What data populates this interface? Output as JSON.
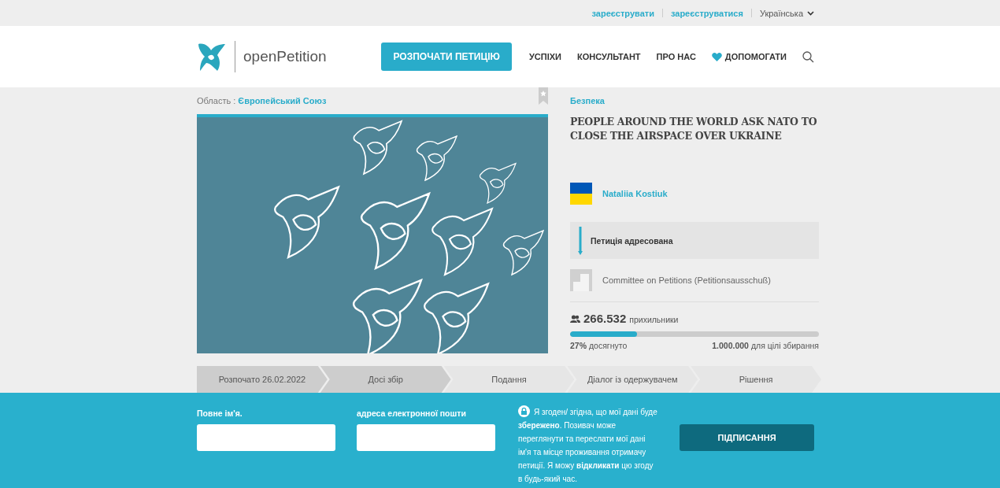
{
  "top_bar": {
    "links": [
      "зареєструвати",
      "зареєструватися"
    ],
    "language": "Українська"
  },
  "header": {
    "logo_text": "openPetition",
    "start_button": "РОЗПОЧАТИ ПЕТИЦІЮ",
    "nav": [
      {
        "label": "УСПІХИ",
        "kind": "plain"
      },
      {
        "label": "КОНСУЛЬТАНТ",
        "kind": "plain"
      },
      {
        "label": "ПРО НАС",
        "kind": "plain"
      },
      {
        "label": "ДОПОМОГАТИ",
        "kind": "heart"
      }
    ]
  },
  "region": {
    "label": "Область :",
    "value": "Європейський Союз"
  },
  "petition": {
    "category": "Безпека",
    "title": "PEOPLE AROUND THE WORLD ASK NATO TO CLOSE THE AIRSPACE OVER UKRAINE",
    "author": "Nataliia Kostiuk",
    "addressed_label": "Петиція адресована",
    "recipient": "Committee on Petitions (Petitionsausschuß)",
    "supporters_count": "266.532",
    "supporters_label": "прихильники",
    "level": 0.27,
    "percent": "27%",
    "percent_label": "досягнуто",
    "goal": "1.000.000",
    "goal_label": "для цілі збирання"
  },
  "steps": [
    {
      "label": "Розпочато 26.02.2022",
      "done": true
    },
    {
      "label": "Досі збір",
      "done": true
    },
    {
      "label": "Подання",
      "done": false
    },
    {
      "label": "Діалог із одержувачем",
      "done": false
    },
    {
      "label": "Рішення",
      "done": false
    }
  ],
  "form": {
    "name_label": "Повне ім'я.",
    "email_label": "адреса електронної пошти",
    "consent": "Я згоден/ згідна, що мої дані буде **збережено**. Позивач може переглянути та переслати мої дані ім'я та місце проживання отримачу петиції. Я можу **відкликати** цю згоду в будь-який час.",
    "submit": "ПІДПИСАННЯ"
  }
}
